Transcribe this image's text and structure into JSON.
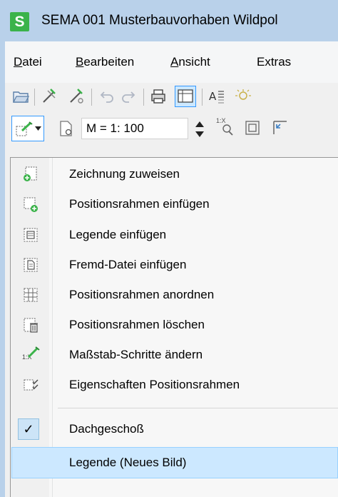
{
  "window": {
    "app_icon_letter": "S",
    "title": "SEMA  001 Musterbauvorhaben Wildpol"
  },
  "menubar": {
    "items": [
      {
        "accel": "D",
        "rest": "atei"
      },
      {
        "accel": "B",
        "rest": "earbeiten"
      },
      {
        "accel": "A",
        "rest": "nsicht"
      },
      {
        "accel": "",
        "rest": "Extras"
      }
    ]
  },
  "toolbar2": {
    "scale_value": "M = 1: 100",
    "scale_step_icon_text": "1:X"
  },
  "dropdown": {
    "items": [
      {
        "label": "Zeichnung zuweisen",
        "icon": "assign-drawing-icon"
      },
      {
        "label": "Positionsrahmen einfügen",
        "icon": "insert-frame-icon"
      },
      {
        "label": "Legende einfügen",
        "icon": "insert-legend-icon"
      },
      {
        "label": "Fremd-Datei einfügen",
        "icon": "insert-file-icon"
      },
      {
        "label": "Positionsrahmen anordnen",
        "icon": "arrange-frames-icon"
      },
      {
        "label": "Positionsrahmen löschen",
        "icon": "delete-frame-icon"
      },
      {
        "label": "Maßstab-Schritte ändern",
        "icon": "scale-steps-icon",
        "icon_text": "1:X"
      },
      {
        "label": "Eigenschaften Positionsrahmen",
        "icon": "frame-properties-icon"
      }
    ],
    "checked_item": {
      "label": "Dachgeschoß",
      "checked": true,
      "check_glyph": "✓"
    },
    "highlighted_item": {
      "label": "Legende (Neues Bild)"
    }
  },
  "colors": {
    "title_bar": "#b9d1ea",
    "app_icon": "#3bb34a",
    "highlight": "#cce8ff",
    "accent_border": "#3399ff"
  }
}
